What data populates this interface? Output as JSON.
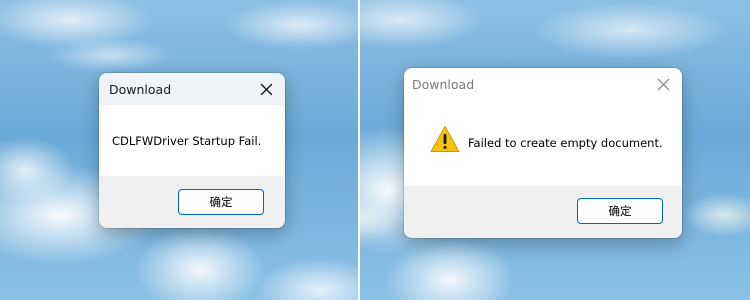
{
  "left_dialog": {
    "title": "Download",
    "close_icon": "close-icon",
    "message": "CDLFWDriver Startup Fail.",
    "ok_label": "确定"
  },
  "right_dialog": {
    "title": "Download",
    "close_icon": "close-icon",
    "icon": "warning-icon",
    "message": "Failed to create empty document.",
    "ok_label": "确定"
  },
  "colors": {
    "button_border": "#0067c0",
    "warning_fill": "#f4c20d"
  }
}
